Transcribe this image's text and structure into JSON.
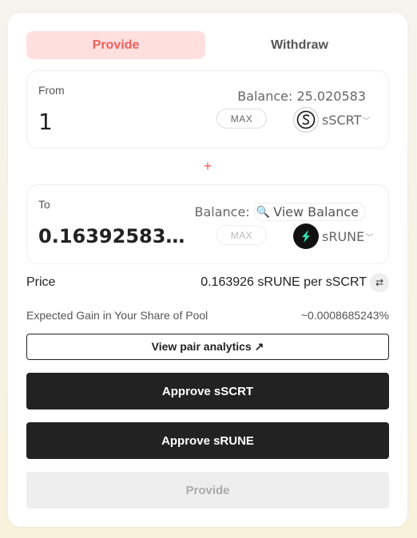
{
  "tabs": {
    "provide_label": "Provide",
    "withdraw_label": "Withdraw"
  },
  "from": {
    "label": "From",
    "balance_text": "Balance: 25.020583",
    "amount": "1",
    "max_label": "MAX",
    "token": "sSCRT",
    "token_icon": "scrt-logo-icon"
  },
  "plus_sign": "+",
  "to": {
    "label": "To",
    "balance_prefix": "Balance:",
    "view_balance_label": "View Balance",
    "amount": "0.16392583…",
    "max_label": "MAX",
    "token": "sRUNE",
    "token_icon": "rune-logo-icon"
  },
  "price": {
    "label": "Price",
    "value": "0.163926 sRUNE per sSCRT",
    "swap_icon": "swap-arrows-icon"
  },
  "gain": {
    "label": "Expected Gain in Your Share of Pool",
    "value": "~0.0008685243%"
  },
  "buttons": {
    "analytics_label": "View pair analytics ↗",
    "approve_from_label": "Approve sSCRT",
    "approve_to_label": "Approve sRUNE",
    "provide_label": "Provide"
  },
  "colors": {
    "accent": "#f0605c",
    "accent_bg": "#ffe0df",
    "dark_button": "#222222",
    "disabled_button": "#eeeeee",
    "rune_green": "#33e0b0"
  }
}
